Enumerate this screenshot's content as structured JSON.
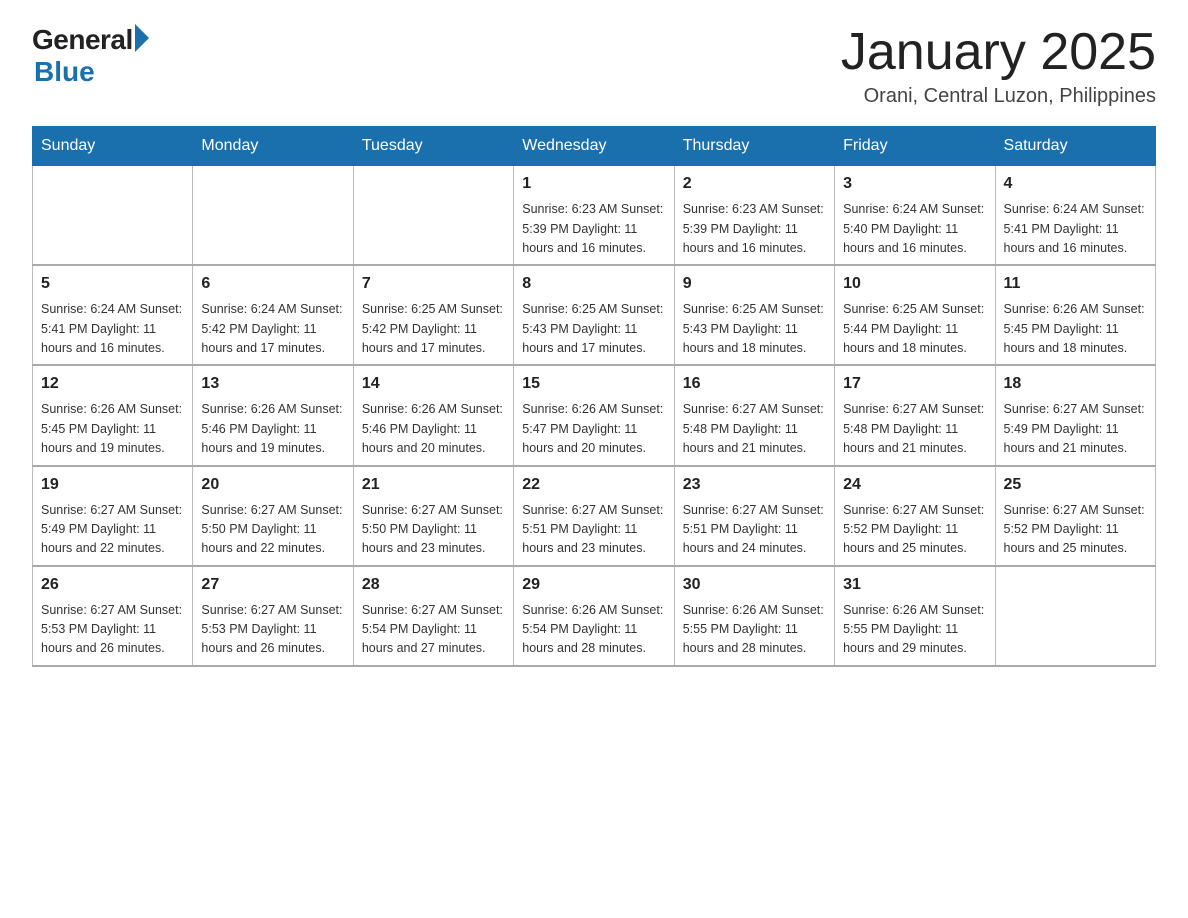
{
  "logo": {
    "general": "General",
    "blue": "Blue"
  },
  "title": "January 2025",
  "subtitle": "Orani, Central Luzon, Philippines",
  "days_of_week": [
    "Sunday",
    "Monday",
    "Tuesday",
    "Wednesday",
    "Thursday",
    "Friday",
    "Saturday"
  ],
  "weeks": [
    [
      {
        "day": "",
        "info": ""
      },
      {
        "day": "",
        "info": ""
      },
      {
        "day": "",
        "info": ""
      },
      {
        "day": "1",
        "info": "Sunrise: 6:23 AM\nSunset: 5:39 PM\nDaylight: 11 hours and 16 minutes."
      },
      {
        "day": "2",
        "info": "Sunrise: 6:23 AM\nSunset: 5:39 PM\nDaylight: 11 hours and 16 minutes."
      },
      {
        "day": "3",
        "info": "Sunrise: 6:24 AM\nSunset: 5:40 PM\nDaylight: 11 hours and 16 minutes."
      },
      {
        "day": "4",
        "info": "Sunrise: 6:24 AM\nSunset: 5:41 PM\nDaylight: 11 hours and 16 minutes."
      }
    ],
    [
      {
        "day": "5",
        "info": "Sunrise: 6:24 AM\nSunset: 5:41 PM\nDaylight: 11 hours and 16 minutes."
      },
      {
        "day": "6",
        "info": "Sunrise: 6:24 AM\nSunset: 5:42 PM\nDaylight: 11 hours and 17 minutes."
      },
      {
        "day": "7",
        "info": "Sunrise: 6:25 AM\nSunset: 5:42 PM\nDaylight: 11 hours and 17 minutes."
      },
      {
        "day": "8",
        "info": "Sunrise: 6:25 AM\nSunset: 5:43 PM\nDaylight: 11 hours and 17 minutes."
      },
      {
        "day": "9",
        "info": "Sunrise: 6:25 AM\nSunset: 5:43 PM\nDaylight: 11 hours and 18 minutes."
      },
      {
        "day": "10",
        "info": "Sunrise: 6:25 AM\nSunset: 5:44 PM\nDaylight: 11 hours and 18 minutes."
      },
      {
        "day": "11",
        "info": "Sunrise: 6:26 AM\nSunset: 5:45 PM\nDaylight: 11 hours and 18 minutes."
      }
    ],
    [
      {
        "day": "12",
        "info": "Sunrise: 6:26 AM\nSunset: 5:45 PM\nDaylight: 11 hours and 19 minutes."
      },
      {
        "day": "13",
        "info": "Sunrise: 6:26 AM\nSunset: 5:46 PM\nDaylight: 11 hours and 19 minutes."
      },
      {
        "day": "14",
        "info": "Sunrise: 6:26 AM\nSunset: 5:46 PM\nDaylight: 11 hours and 20 minutes."
      },
      {
        "day": "15",
        "info": "Sunrise: 6:26 AM\nSunset: 5:47 PM\nDaylight: 11 hours and 20 minutes."
      },
      {
        "day": "16",
        "info": "Sunrise: 6:27 AM\nSunset: 5:48 PM\nDaylight: 11 hours and 21 minutes."
      },
      {
        "day": "17",
        "info": "Sunrise: 6:27 AM\nSunset: 5:48 PM\nDaylight: 11 hours and 21 minutes."
      },
      {
        "day": "18",
        "info": "Sunrise: 6:27 AM\nSunset: 5:49 PM\nDaylight: 11 hours and 21 minutes."
      }
    ],
    [
      {
        "day": "19",
        "info": "Sunrise: 6:27 AM\nSunset: 5:49 PM\nDaylight: 11 hours and 22 minutes."
      },
      {
        "day": "20",
        "info": "Sunrise: 6:27 AM\nSunset: 5:50 PM\nDaylight: 11 hours and 22 minutes."
      },
      {
        "day": "21",
        "info": "Sunrise: 6:27 AM\nSunset: 5:50 PM\nDaylight: 11 hours and 23 minutes."
      },
      {
        "day": "22",
        "info": "Sunrise: 6:27 AM\nSunset: 5:51 PM\nDaylight: 11 hours and 23 minutes."
      },
      {
        "day": "23",
        "info": "Sunrise: 6:27 AM\nSunset: 5:51 PM\nDaylight: 11 hours and 24 minutes."
      },
      {
        "day": "24",
        "info": "Sunrise: 6:27 AM\nSunset: 5:52 PM\nDaylight: 11 hours and 25 minutes."
      },
      {
        "day": "25",
        "info": "Sunrise: 6:27 AM\nSunset: 5:52 PM\nDaylight: 11 hours and 25 minutes."
      }
    ],
    [
      {
        "day": "26",
        "info": "Sunrise: 6:27 AM\nSunset: 5:53 PM\nDaylight: 11 hours and 26 minutes."
      },
      {
        "day": "27",
        "info": "Sunrise: 6:27 AM\nSunset: 5:53 PM\nDaylight: 11 hours and 26 minutes."
      },
      {
        "day": "28",
        "info": "Sunrise: 6:27 AM\nSunset: 5:54 PM\nDaylight: 11 hours and 27 minutes."
      },
      {
        "day": "29",
        "info": "Sunrise: 6:26 AM\nSunset: 5:54 PM\nDaylight: 11 hours and 28 minutes."
      },
      {
        "day": "30",
        "info": "Sunrise: 6:26 AM\nSunset: 5:55 PM\nDaylight: 11 hours and 28 minutes."
      },
      {
        "day": "31",
        "info": "Sunrise: 6:26 AM\nSunset: 5:55 PM\nDaylight: 11 hours and 29 minutes."
      },
      {
        "day": "",
        "info": ""
      }
    ]
  ]
}
